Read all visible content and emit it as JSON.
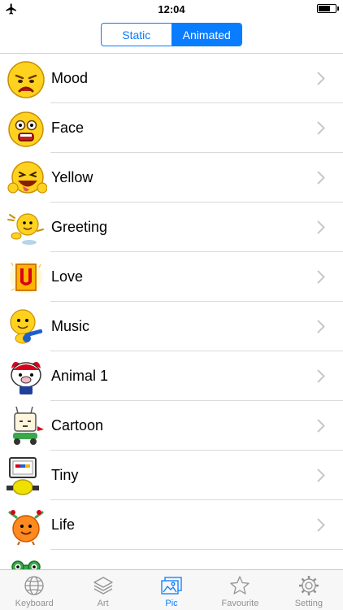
{
  "status_bar": {
    "time": "12:04",
    "airplane_mode": true
  },
  "segments": [
    {
      "label": "Static",
      "selected": false
    },
    {
      "label": "Animated",
      "selected": true
    }
  ],
  "categories": [
    {
      "label": "Mood",
      "icon": "sad-smiley-icon"
    },
    {
      "label": "Face",
      "icon": "shocked-smiley-icon"
    },
    {
      "label": "Yellow",
      "icon": "laughing-smiley-icon"
    },
    {
      "label": "Greeting",
      "icon": "waving-smiley-icon"
    },
    {
      "label": "Love",
      "icon": "love-letter-icon"
    },
    {
      "label": "Music",
      "icon": "guitar-smiley-icon"
    },
    {
      "label": "Animal 1",
      "icon": "pig-character-icon"
    },
    {
      "label": "Cartoon",
      "icon": "cartoon-rabbit-icon"
    },
    {
      "label": "Tiny",
      "icon": "computer-ball-icon"
    },
    {
      "label": "Life",
      "icon": "orange-bird-icon"
    },
    {
      "label": "",
      "icon": "frog-icon"
    }
  ],
  "tabs": [
    {
      "label": "Keyboard",
      "icon": "globe-icon",
      "active": false
    },
    {
      "label": "Art",
      "icon": "layers-icon",
      "active": false
    },
    {
      "label": "Pic",
      "icon": "pictures-icon",
      "active": true
    },
    {
      "label": "Favourite",
      "icon": "star-icon",
      "active": false
    },
    {
      "label": "Setting",
      "icon": "gear-icon",
      "active": false
    }
  ],
  "colors": {
    "accent": "#0a7cff",
    "tab_inactive": "#929292",
    "smiley_yellow": "#ffd21f"
  }
}
